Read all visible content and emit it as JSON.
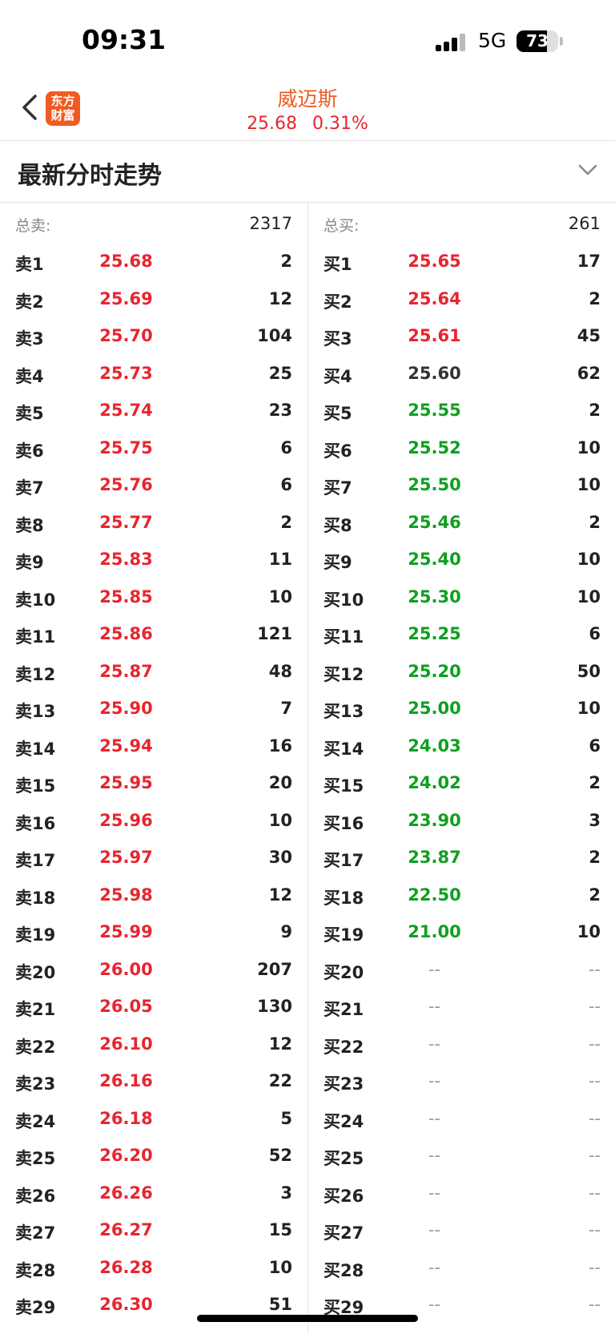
{
  "status_bar": {
    "time": "09:31",
    "network": "5G",
    "battery": "73"
  },
  "header": {
    "logo_text": "东方财富",
    "stock_name": "威迈斯",
    "price": "25.68",
    "change_pct": "0.31%"
  },
  "section": {
    "title": "最新分时走势"
  },
  "sell": {
    "total_label": "总卖:",
    "total_value": "2317",
    "rows": [
      {
        "label": "卖1",
        "price": "25.68",
        "vol": "2",
        "color": "red"
      },
      {
        "label": "卖2",
        "price": "25.69",
        "vol": "12",
        "color": "red"
      },
      {
        "label": "卖3",
        "price": "25.70",
        "vol": "104",
        "color": "red"
      },
      {
        "label": "卖4",
        "price": "25.73",
        "vol": "25",
        "color": "red"
      },
      {
        "label": "卖5",
        "price": "25.74",
        "vol": "23",
        "color": "red"
      },
      {
        "label": "卖6",
        "price": "25.75",
        "vol": "6",
        "color": "red"
      },
      {
        "label": "卖7",
        "price": "25.76",
        "vol": "6",
        "color": "red"
      },
      {
        "label": "卖8",
        "price": "25.77",
        "vol": "2",
        "color": "red"
      },
      {
        "label": "卖9",
        "price": "25.83",
        "vol": "11",
        "color": "red"
      },
      {
        "label": "卖10",
        "price": "25.85",
        "vol": "10",
        "color": "red"
      },
      {
        "label": "卖11",
        "price": "25.86",
        "vol": "121",
        "color": "red"
      },
      {
        "label": "卖12",
        "price": "25.87",
        "vol": "48",
        "color": "red"
      },
      {
        "label": "卖13",
        "price": "25.90",
        "vol": "7",
        "color": "red"
      },
      {
        "label": "卖14",
        "price": "25.94",
        "vol": "16",
        "color": "red"
      },
      {
        "label": "卖15",
        "price": "25.95",
        "vol": "20",
        "color": "red"
      },
      {
        "label": "卖16",
        "price": "25.96",
        "vol": "10",
        "color": "red"
      },
      {
        "label": "卖17",
        "price": "25.97",
        "vol": "30",
        "color": "red"
      },
      {
        "label": "卖18",
        "price": "25.98",
        "vol": "12",
        "color": "red"
      },
      {
        "label": "卖19",
        "price": "25.99",
        "vol": "9",
        "color": "red"
      },
      {
        "label": "卖20",
        "price": "26.00",
        "vol": "207",
        "color": "red"
      },
      {
        "label": "卖21",
        "price": "26.05",
        "vol": "130",
        "color": "red"
      },
      {
        "label": "卖22",
        "price": "26.10",
        "vol": "12",
        "color": "red"
      },
      {
        "label": "卖23",
        "price": "26.16",
        "vol": "22",
        "color": "red"
      },
      {
        "label": "卖24",
        "price": "26.18",
        "vol": "5",
        "color": "red"
      },
      {
        "label": "卖25",
        "price": "26.20",
        "vol": "52",
        "color": "red"
      },
      {
        "label": "卖26",
        "price": "26.26",
        "vol": "3",
        "color": "red"
      },
      {
        "label": "卖27",
        "price": "26.27",
        "vol": "15",
        "color": "red"
      },
      {
        "label": "卖28",
        "price": "26.28",
        "vol": "10",
        "color": "red"
      },
      {
        "label": "卖29",
        "price": "26.30",
        "vol": "51",
        "color": "red"
      }
    ]
  },
  "buy": {
    "total_label": "总买:",
    "total_value": "261",
    "rows": [
      {
        "label": "买1",
        "price": "25.65",
        "vol": "17",
        "color": "red"
      },
      {
        "label": "买2",
        "price": "25.64",
        "vol": "2",
        "color": "red"
      },
      {
        "label": "买3",
        "price": "25.61",
        "vol": "45",
        "color": "red"
      },
      {
        "label": "买4",
        "price": "25.60",
        "vol": "62",
        "color": "dark"
      },
      {
        "label": "买5",
        "price": "25.55",
        "vol": "2",
        "color": "green"
      },
      {
        "label": "买6",
        "price": "25.52",
        "vol": "10",
        "color": "green"
      },
      {
        "label": "买7",
        "price": "25.50",
        "vol": "10",
        "color": "green"
      },
      {
        "label": "买8",
        "price": "25.46",
        "vol": "2",
        "color": "green"
      },
      {
        "label": "买9",
        "price": "25.40",
        "vol": "10",
        "color": "green"
      },
      {
        "label": "买10",
        "price": "25.30",
        "vol": "10",
        "color": "green"
      },
      {
        "label": "买11",
        "price": "25.25",
        "vol": "6",
        "color": "green"
      },
      {
        "label": "买12",
        "price": "25.20",
        "vol": "50",
        "color": "green"
      },
      {
        "label": "买13",
        "price": "25.00",
        "vol": "10",
        "color": "green"
      },
      {
        "label": "买14",
        "price": "24.03",
        "vol": "6",
        "color": "green"
      },
      {
        "label": "买15",
        "price": "24.02",
        "vol": "2",
        "color": "green"
      },
      {
        "label": "买16",
        "price": "23.90",
        "vol": "3",
        "color": "green"
      },
      {
        "label": "买17",
        "price": "23.87",
        "vol": "2",
        "color": "green"
      },
      {
        "label": "买18",
        "price": "22.50",
        "vol": "2",
        "color": "green"
      },
      {
        "label": "买19",
        "price": "21.00",
        "vol": "10",
        "color": "green"
      },
      {
        "label": "买20",
        "price": "--",
        "vol": "--",
        "color": "dash"
      },
      {
        "label": "买21",
        "price": "--",
        "vol": "--",
        "color": "dash"
      },
      {
        "label": "买22",
        "price": "--",
        "vol": "--",
        "color": "dash"
      },
      {
        "label": "买23",
        "price": "--",
        "vol": "--",
        "color": "dash"
      },
      {
        "label": "买24",
        "price": "--",
        "vol": "--",
        "color": "dash"
      },
      {
        "label": "买25",
        "price": "--",
        "vol": "--",
        "color": "dash"
      },
      {
        "label": "买26",
        "price": "--",
        "vol": "--",
        "color": "dash"
      },
      {
        "label": "买27",
        "price": "--",
        "vol": "--",
        "color": "dash"
      },
      {
        "label": "买28",
        "price": "--",
        "vol": "--",
        "color": "dash"
      },
      {
        "label": "买29",
        "price": "--",
        "vol": "--",
        "color": "dash"
      }
    ]
  },
  "colors": {
    "red": "#e8252f",
    "green": "#0f9f1f",
    "accent": "#ef5b22"
  }
}
